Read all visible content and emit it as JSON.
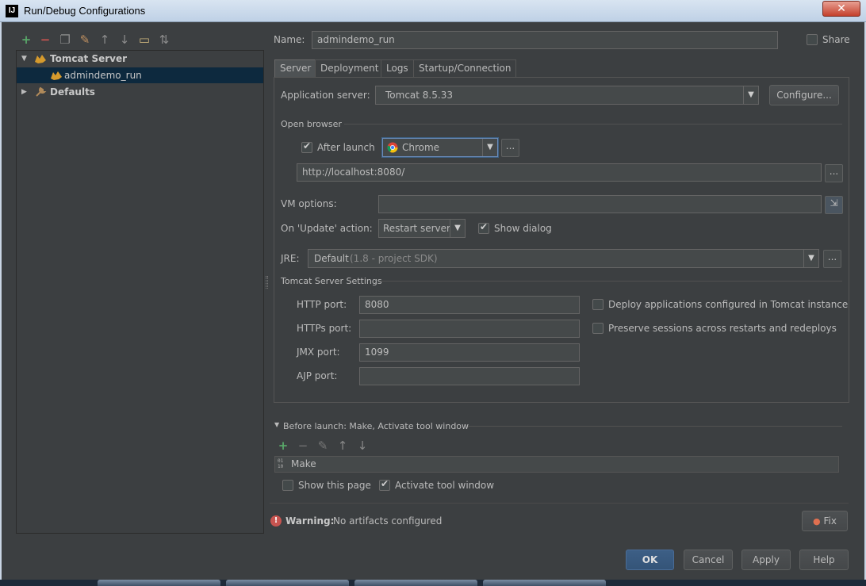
{
  "window": {
    "title": "Run/Debug Configurations",
    "app_icon": "IJ"
  },
  "toolbar": {
    "icons": [
      "add-icon",
      "remove-icon",
      "copy-icon",
      "wrench-icon",
      "move-up-icon",
      "move-down-icon",
      "folder-icon",
      "sort-icon"
    ]
  },
  "tree": {
    "items": [
      {
        "label": "Tomcat Server",
        "bold": true,
        "expanded": true
      },
      {
        "label": "admindemo_run",
        "selected": true
      },
      {
        "label": "Defaults",
        "bold": true,
        "expanded": false
      }
    ]
  },
  "config": {
    "name_label": "Name:",
    "name_value": "admindemo_run",
    "share_label": "Share",
    "share_checked": false
  },
  "tabs": [
    {
      "label": "Server",
      "active": true
    },
    {
      "label": "Deployment"
    },
    {
      "label": "Logs"
    },
    {
      "label": "Startup/Connection"
    }
  ],
  "server": {
    "app_server_label": "Application server:",
    "app_server_value": "Tomcat 8.5.33",
    "configure_label": "Configure...",
    "open_browser_label": "Open browser",
    "after_launch_label": "After launch",
    "after_launch_checked": true,
    "browser_value": "Chrome",
    "url_value": "http://localhost:8080/",
    "vm_options_label": "VM options:",
    "vm_options_value": "",
    "on_update_label": "On 'Update' action:",
    "on_update_value": "Restart server",
    "show_dialog_label": "Show dialog",
    "show_dialog_checked": true,
    "jre_label": "JRE:",
    "jre_value": "Default",
    "jre_hint": "(1.8 - project SDK)",
    "tomcat_settings_label": "Tomcat Server Settings",
    "http_port_label": "HTTP port:",
    "http_port_value": "8080",
    "https_port_label": "HTTPs port:",
    "https_port_value": "",
    "jmx_port_label": "JMX port:",
    "jmx_port_value": "1099",
    "ajp_port_label": "AJP port:",
    "ajp_port_value": "",
    "deploy_apps_label": "Deploy applications configured in Tomcat instance",
    "deploy_apps_checked": false,
    "preserve_sessions_label": "Preserve sessions across restarts and redeploys",
    "preserve_sessions_checked": false
  },
  "before_launch": {
    "header": "Before launch: Make, Activate tool window",
    "items": [
      {
        "label": "Make"
      }
    ],
    "show_page_label": "Show this page",
    "show_page_checked": false,
    "activate_label": "Activate tool window",
    "activate_checked": true
  },
  "warning": {
    "title": "Warning:",
    "message": "No artifacts configured",
    "fix_label": "Fix"
  },
  "buttons": {
    "ok": "OK",
    "cancel": "Cancel",
    "apply": "Apply",
    "help": "Help"
  },
  "colors": {
    "bg": "#3c3f41",
    "field": "#45494a",
    "selection": "#0d293e",
    "add": "#59a869",
    "remove": "#c75450",
    "warning": "#c75450"
  }
}
